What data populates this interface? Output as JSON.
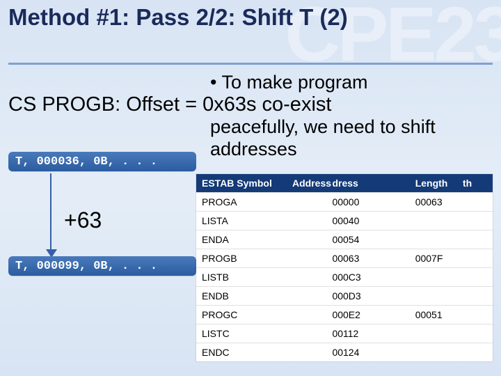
{
  "watermark": "CPE23",
  "title": "Method #1: Pass 2/2: Shift T (2)",
  "bullet_lead": "•  To make program",
  "cs_line": "CS PROGB: Offset = 0x63s co-exist",
  "rest_text": "peacefully, we need to shift addresses",
  "code1": "T, 000036, 0B, . . .",
  "code2": "T, 000099, 0B, . . .",
  "plus63": "+63",
  "table": {
    "headers": {
      "col1_main": "ESTAB Symbol",
      "col1_overlay": "Address",
      "col2": "dress",
      "col3": "Length",
      "col3_overlay": "th"
    },
    "rows": [
      {
        "sym": "PROGA",
        "addr": "00000",
        "len": "00063"
      },
      {
        "sym": "LISTA",
        "addr": "00040",
        "len": ""
      },
      {
        "sym": "ENDA",
        "addr": "00054",
        "len": ""
      },
      {
        "sym": "PROGB",
        "addr": "00063",
        "len": "0007F"
      },
      {
        "sym": "LISTB",
        "addr": "000C3",
        "len": ""
      },
      {
        "sym": "ENDB",
        "addr": "000D3",
        "len": ""
      },
      {
        "sym": "PROGC",
        "addr": "000E2",
        "len": "00051"
      },
      {
        "sym": "LISTC",
        "addr": "00112",
        "len": ""
      },
      {
        "sym": "ENDC",
        "addr": "00124",
        "len": ""
      }
    ]
  }
}
